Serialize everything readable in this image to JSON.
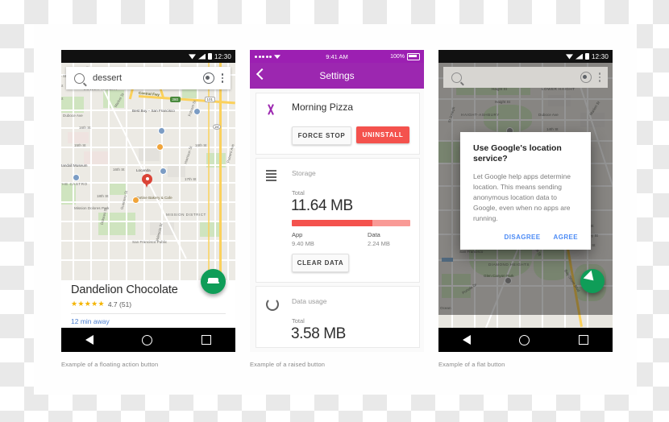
{
  "sheet": {
    "captions": [
      "Example of a floating action button",
      "Example of a raised button",
      "Example of a flat button"
    ]
  },
  "phone1": {
    "statusbar": {
      "time": "12:30",
      "wifi_icon": "wifi-icon",
      "signal_icon": "signal-icon",
      "battery_icon": "battery-icon"
    },
    "search": {
      "query": "dessert",
      "placeholder": "Search",
      "search_icon": "search-icon",
      "location_icon": "my-location-icon",
      "overflow_icon": "more-vert-icon"
    },
    "map": {
      "labels": [
        "McAllister St",
        "LOWER HAIGHT",
        "Duboce Ave",
        "Market St",
        "Central Fwy",
        "Best Buy - San Francisco",
        "16th St",
        "15th St",
        "16th St",
        "Locanda",
        "Randall Museum",
        "Tartine Bakery & Cafe",
        "17th St",
        "18th St",
        "Folsom St",
        "Guerrero St",
        "Dolores St",
        "Valencia St",
        "Potrero Ave",
        "Pulaski Ave",
        "MISSION DISTRICT",
        "Mission Dolores Park",
        "San Francisco Public",
        "THE CASTRO",
        "Harrison St",
        "Shotwell St",
        "8th St",
        "e St",
        "St"
      ],
      "shields": [
        "101",
        "24",
        "280"
      ],
      "pin_icon": "map-pin-icon"
    },
    "fab": {
      "icon": "directions-car-icon",
      "color": "#0f9d58"
    },
    "place": {
      "title": "Dandelion Chocolate",
      "stars": "★★★★★",
      "rating": "4.7 (51)",
      "eta": "12 min away"
    },
    "nav": {
      "back_icon": "nav-back-icon",
      "home_icon": "nav-home-icon",
      "recents_icon": "nav-recents-icon"
    }
  },
  "phone2": {
    "statusbar": {
      "time": "9:41 AM",
      "battery_pct": "100%",
      "signal_icon": "signal-dots-icon",
      "wifi_icon": "wifi-icon",
      "battery_icon": "battery-icon"
    },
    "appbar": {
      "title": "Settings",
      "back_icon": "back-chevron-icon",
      "color": "#9c27b0"
    },
    "app": {
      "icon": "fork-knife-icon",
      "name": "Morning Pizza",
      "force_stop_label": "FORCE STOP",
      "uninstall_label": "UNINSTALL",
      "uninstall_color": "#f4524d"
    },
    "storage": {
      "icon": "storage-lines-icon",
      "header": "Storage",
      "total_label": "Total",
      "total_value": "11.64 MB",
      "app_label": "App",
      "app_value": "9.40 MB",
      "data_label": "Data",
      "data_value": "2.24 MB",
      "app_pct": 68,
      "clear_label": "CLEAR DATA"
    },
    "data_usage": {
      "icon": "data-ring-icon",
      "header": "Data usage",
      "total_label": "Total",
      "total_value": "3.58 MB"
    }
  },
  "phone3": {
    "statusbar": {
      "time": "12:30",
      "wifi_icon": "wifi-icon",
      "signal_icon": "signal-icon",
      "battery_icon": "battery-icon"
    },
    "search": {
      "placeholder": "",
      "search_icon": "search-icon",
      "location_icon": "my-location-icon",
      "overflow_icon": "more-vert-icon"
    },
    "map": {
      "labels": [
        "HAIGHT-ASHBURY",
        "Haight St",
        "Haight St",
        "LOWER HAIGHT",
        "Duboce Ave",
        "Market St",
        "Ruth Asawa San Francisco",
        "Glen Canyon Park",
        "DIAMOND HEIGHTS",
        "Clipper St",
        "Portola Dr",
        "Ocean Ave",
        "Bosworth St",
        "24th St",
        "Valley St",
        "29th St",
        "8th St",
        "St",
        "Mission St",
        "Bay Shore Blvd"
      ]
    },
    "dialog": {
      "title": "Use Google's location service?",
      "body": "Let Google help apps determine location. This means sending anonymous location data to Google, even when no apps are running.",
      "disagree_label": "DISAGREE",
      "agree_label": "AGREE",
      "link_color": "#4c8bf5"
    },
    "fab": {
      "icon": "navigation-icon",
      "color": "#0f9d58"
    },
    "nav": {
      "back_icon": "nav-back-icon",
      "home_icon": "nav-home-icon",
      "recents_icon": "nav-recents-icon"
    }
  }
}
